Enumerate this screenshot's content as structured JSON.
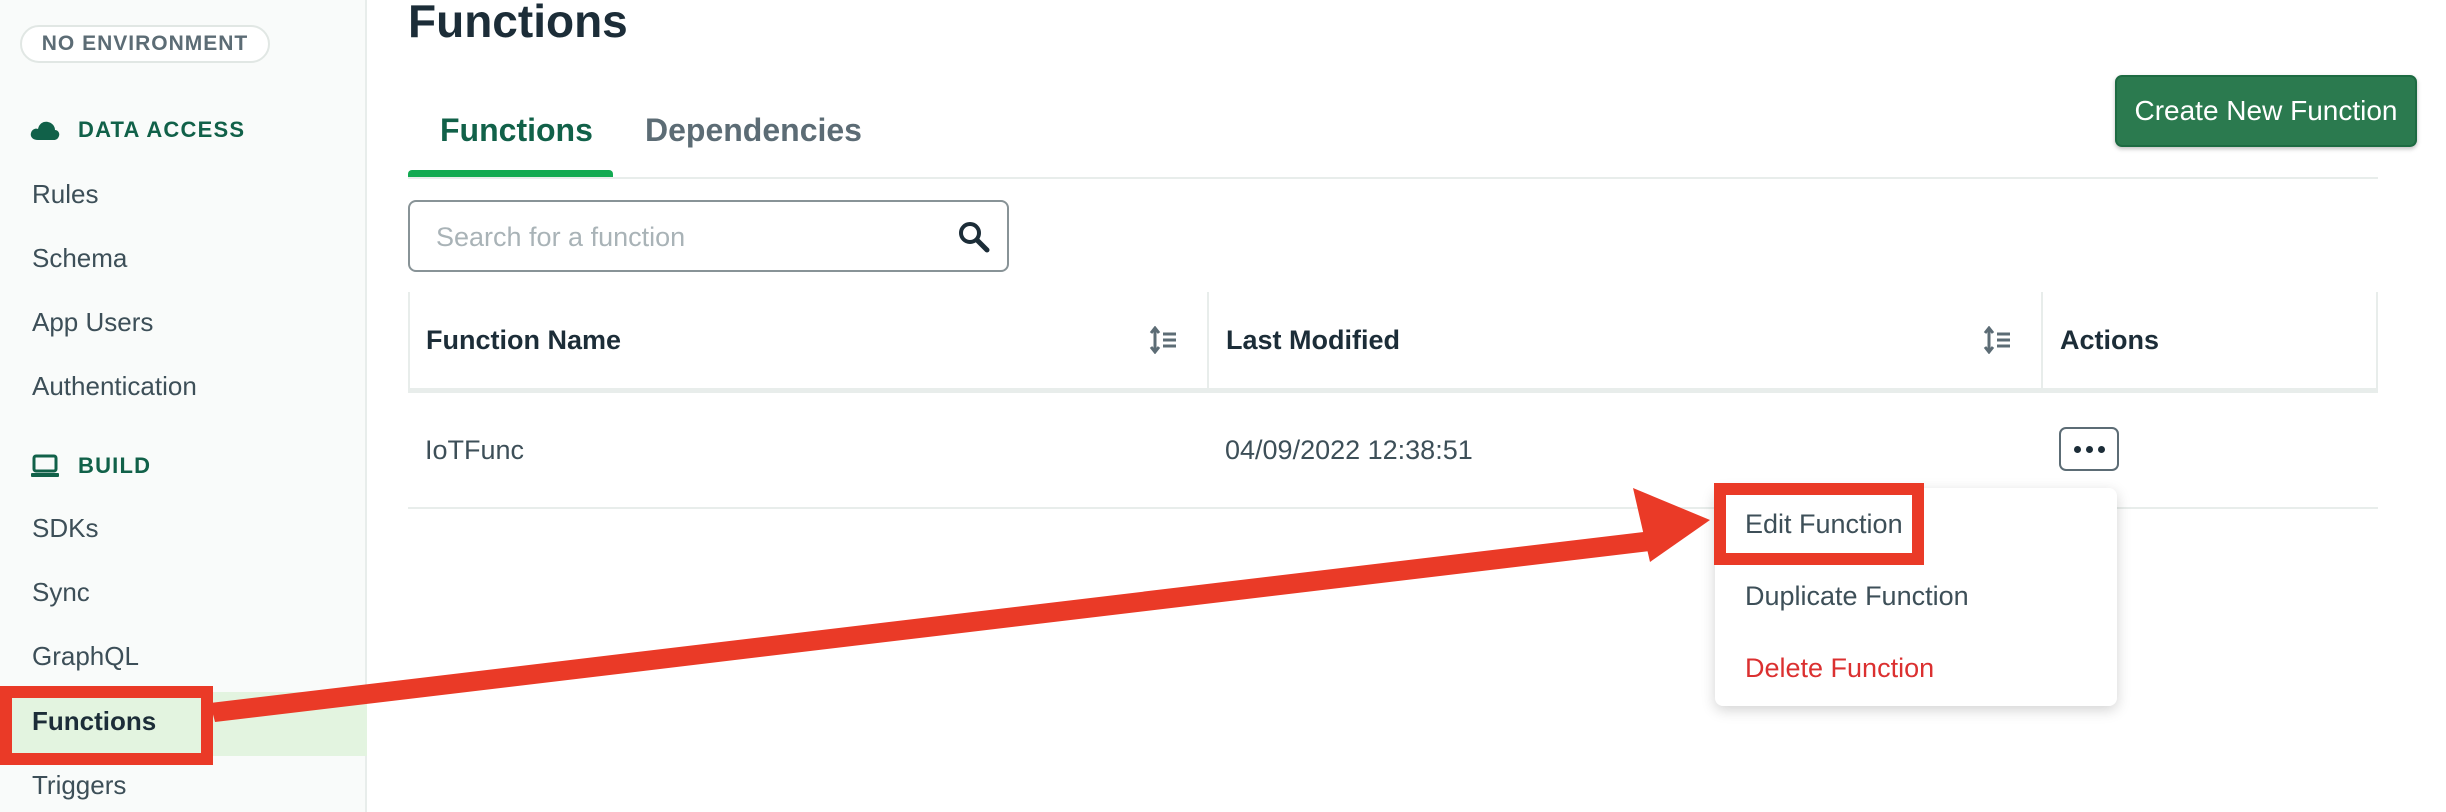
{
  "sidebar": {
    "environment_pill": "NO ENVIRONMENT",
    "sections": [
      {
        "title": "DATA ACCESS",
        "icon": "cloud-icon",
        "items": [
          "Rules",
          "Schema",
          "App Users",
          "Authentication"
        ]
      },
      {
        "title": "BUILD",
        "icon": "laptop-icon",
        "items": [
          "SDKs",
          "Sync",
          "GraphQL",
          "Functions",
          "Triggers"
        ]
      }
    ],
    "active_item": "Functions"
  },
  "main": {
    "page_title": "Functions",
    "tabs": [
      {
        "label": "Functions",
        "active": true
      },
      {
        "label": "Dependencies",
        "active": false
      }
    ],
    "create_button_label": "Create New Function",
    "search": {
      "placeholder": "Search for a function",
      "value": ""
    },
    "table": {
      "columns": [
        "Function Name",
        "Last Modified",
        "Actions"
      ],
      "rows": [
        {
          "name": "IoTFunc",
          "last_modified": "04/09/2022 12:38:51"
        }
      ]
    },
    "actions_menu": {
      "items": [
        "Edit Function",
        "Duplicate Function",
        "Delete Function"
      ]
    }
  },
  "colors": {
    "accent_green": "#13aa52",
    "button_green": "#2b7a4f",
    "danger_red": "#db3030",
    "annotation_red": "#ea3a27",
    "active_nav_bg": "#e3f4e0"
  }
}
